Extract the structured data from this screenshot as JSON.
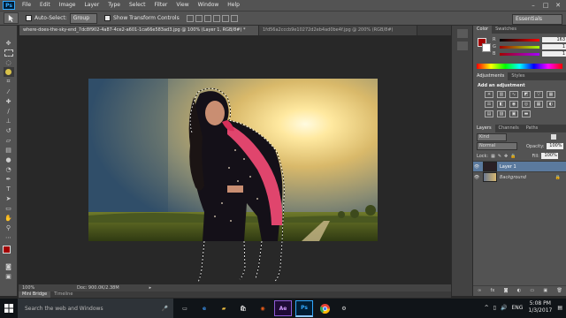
{
  "menubar": {
    "logo": "Ps",
    "items": [
      "File",
      "Edit",
      "Image",
      "Layer",
      "Type",
      "Select",
      "Filter",
      "View",
      "Window",
      "Help"
    ]
  },
  "options": {
    "auto_select_label": "Auto-Select:",
    "auto_select_value": "Group",
    "transform_label": "Show Transform Controls",
    "workspace": "Essentials"
  },
  "tabs": [
    {
      "label": "where-does-the-sky-end_7dc8f902-4a87-4ce2-a601-1ca66e583ad3.jpg @ 100% (Layer 1, RGB/8#) *",
      "active": true
    },
    {
      "label": "1fd56a2cccb9e10272d2eb4ad0be4f.jpg @ 200% (RGB/8#)",
      "active": false
    }
  ],
  "status": {
    "zoom": "100%",
    "doc": "Doc: 900.0K/2.38M"
  },
  "bottom_tabs": [
    "Mini Bridge",
    "Timeline"
  ],
  "color_panel": {
    "tabs": [
      "Color",
      "Swatches"
    ],
    "r_label": "R",
    "g_label": "G",
    "b_label": "B",
    "r": "163",
    "g": "1",
    "b": "1"
  },
  "adjustments_panel": {
    "tabs": [
      "Adjustments",
      "Styles"
    ],
    "heading": "Add an adjustment"
  },
  "layers_panel": {
    "tabs": [
      "Layers",
      "Channels",
      "Paths"
    ],
    "kind": "Kind",
    "blend_mode": "Normal",
    "opacity_label": "Opacity:",
    "opacity": "100%",
    "lock_label": "Lock:",
    "fill_label": "Fill:",
    "fill": "100%",
    "layers": [
      {
        "name": "Layer 1",
        "selected": true
      },
      {
        "name": "Background",
        "selected": false
      }
    ]
  },
  "taskbar": {
    "search": "Search the web and Windows",
    "apps": [
      "Ae",
      "Ps"
    ],
    "lang": "ENG",
    "time": "5:08 PM",
    "date": "1/3/2017"
  },
  "colors": {
    "foreground": "#a30101",
    "background": "#ffffff",
    "accent": "#31a8ff"
  }
}
